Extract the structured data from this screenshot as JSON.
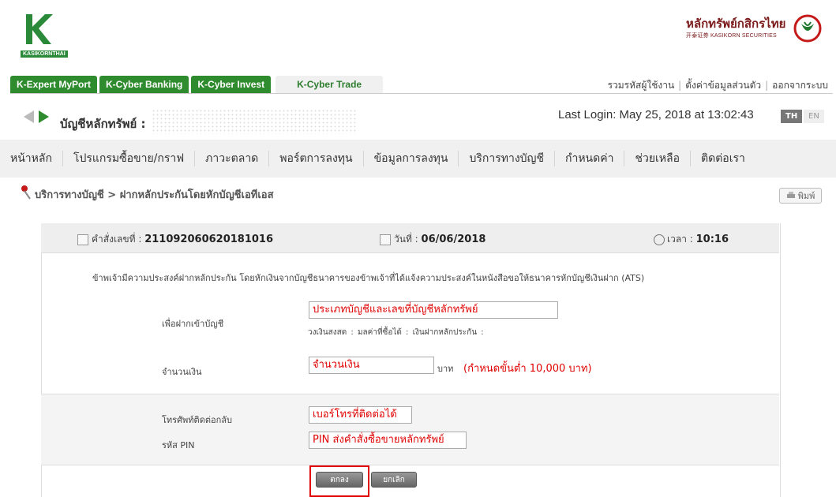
{
  "brand": {
    "logo_text": "KASIKORNTHAI",
    "company_th": "หลักทรัพย์กสิกรไทย",
    "company_en": "开泰证券 KASIKORN SECURITIES",
    "colors": {
      "green": "#2e8b2e",
      "maroon": "#7a1a1a",
      "red": "#e00000"
    }
  },
  "tabs": [
    "K-Expert MyPort",
    "K-Cyber Banking",
    "K-Cyber Invest",
    "K-Cyber Trade"
  ],
  "active_tab": "K-Cyber Trade",
  "top_links": [
    "รวมรหัสผู้ใช้งาน",
    "ตั้งค่าข้อมูลส่วนตัว",
    "ออกจากระบบ"
  ],
  "account": {
    "label": "บัญชีหลักทรัพย์ :"
  },
  "last_login": "Last Login: May 25, 2018 at 13:02:43",
  "lang": {
    "th": "TH",
    "en": "EN"
  },
  "menu": [
    "หน้าหลัก",
    "โปรแกรมซื้อขาย/กราฟ",
    "ภาวะตลาด",
    "พอร์ตการลงทุน",
    "ข้อมูลการลงทุน",
    "บริการทางบัญชี",
    "กำหนดค่า",
    "ช่วยเหลือ",
    "ติดต่อเรา"
  ],
  "breadcrumb": "บริการทางบัญชี > ฝากหลักประกันโดยหักบัญชีเอทีเอส",
  "print_label": "พิมพ์",
  "order": {
    "no_label": "คำสั่งเลขที่ :",
    "no_value": "211092060620181016",
    "date_label": "วันที่ :",
    "date_value": "06/06/2018",
    "time_label": "เวลา :",
    "time_value": "10:16"
  },
  "form": {
    "description": "ข้าพเจ้ามีความประสงค์ฝากหลักประกัน โดยหักเงินจากบัญชีธนาคารของข้าพเจ้าที่ได้แจ้งความประสงค์ในหนังสือขอให้ธนาคารหักบัญชีเงินฝาก (ATS)",
    "deposit_label": "เพื่อฝากเข้าบัญชี",
    "deposit_value": "ประเภทบัญชีและเลขที่บัญชีหลักทรัพย์",
    "sub_info": "วงเงินสงสด :    มลค่าที่ซื้อได้ :    เงินฝากหลักประกัน :",
    "amount_label": "จำนวนเงิน",
    "amount_value": "จำนวนเงิน",
    "amount_unit": "บาท",
    "amount_note": "(กำหนดขั้นต่ำ 10,000 บาท)",
    "phone_label": "โทรศัพท์ติดต่อกลับ",
    "phone_value": "เบอร์โทรที่ติดต่อได้",
    "pin_label": "รหัส PIN",
    "pin_value": "PIN ส่งคำสั่งซื้อขายหลักทรัพย์"
  },
  "buttons": {
    "ok": "ตกลง",
    "cancel": "ยกเลิก"
  }
}
